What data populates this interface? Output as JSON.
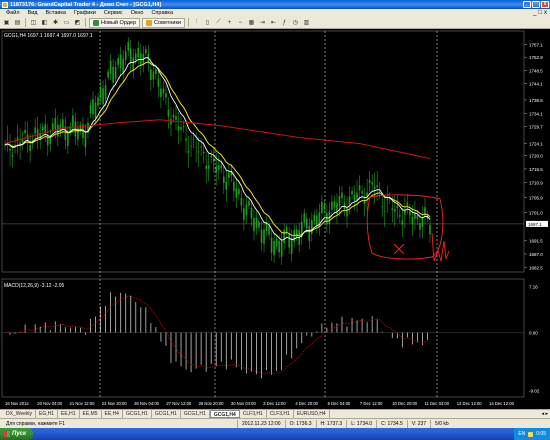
{
  "window": {
    "title": "11873176: GrandCapital Trader 4 - Демо Счет - [GCG1,H4]"
  },
  "menu": {
    "items": [
      "Файл",
      "Вид",
      "Вставка",
      "Графики",
      "Сервис",
      "Окно",
      "Справка"
    ],
    "mdi_controls": [
      "_",
      "□",
      "x"
    ]
  },
  "toolbar": {
    "new_order_label": "Новый Ордер",
    "experts_label": "Советники"
  },
  "chart": {
    "symbol_line": "GCG1,H4  1697.1 1697.4 1697.0 1697.1",
    "macd_label": "MACD(12,26,9) -3.12 -2.05",
    "current_price": "1697.1",
    "price_ticks": [
      "1757.1",
      "1752.9",
      "1748.5",
      "1744.1",
      "1738.6",
      "1734.1",
      "1729.7",
      "1724.1",
      "1720.0",
      "1715.5",
      "1710.9",
      "1705.9",
      "1701.0",
      "1691.5",
      "1687.0",
      "1682.5"
    ],
    "macd_ticks": [
      "7.16",
      "0.00",
      "-9.02"
    ],
    "date_ticks": [
      "16 Nov 2012",
      "20 Nov 04:00",
      "21 Nov 12:00",
      "22 Nov 20:00",
      "26 Nov 04:00",
      "27 Nov 12:00",
      "28 Nov 20:00",
      "30 Nov 04:00",
      "3 Dec 12:00",
      "4 Dec 20:00",
      "6 Dec 04:00",
      "7 Dec 12:00",
      "10 Dec 20:00",
      "11 Dec 04:00",
      "13 Dec 12:00",
      "14 Dec 12:00"
    ],
    "colors": {
      "background": "#000000",
      "candles": "#1aa31a",
      "ma_fast": "#ffffff",
      "ma_slow": "#f0e020",
      "ma_long": "#d01010",
      "macd_hist": "#c8c8c8",
      "macd_signal": "#c01010",
      "annotation": "#ff2020"
    }
  },
  "tabs": {
    "items": [
      "DX_Weekly",
      "EG,H1",
      "EE,H1",
      "EE,M5",
      "EE,H4",
      "GCG1,H1",
      "GCG1,H1",
      "GCG1,H1",
      "GCG1,H4",
      "CLF3,H1",
      "CLF3,H1",
      "EURUSD,H4"
    ],
    "active_index": 8
  },
  "status": {
    "help": "Для справки, нажмите F1",
    "datetime": "2012.11.23 12:00",
    "open": "O: 1736.3",
    "high": "H: 1737.3",
    "low": "L: 1734.0",
    "close": "C: 1734.5",
    "volume": "V: 237",
    "traffic": "5/0 kb"
  },
  "taskbar": {
    "start_label": "Пуск",
    "lang": "EN",
    "clock": "0:05"
  }
}
